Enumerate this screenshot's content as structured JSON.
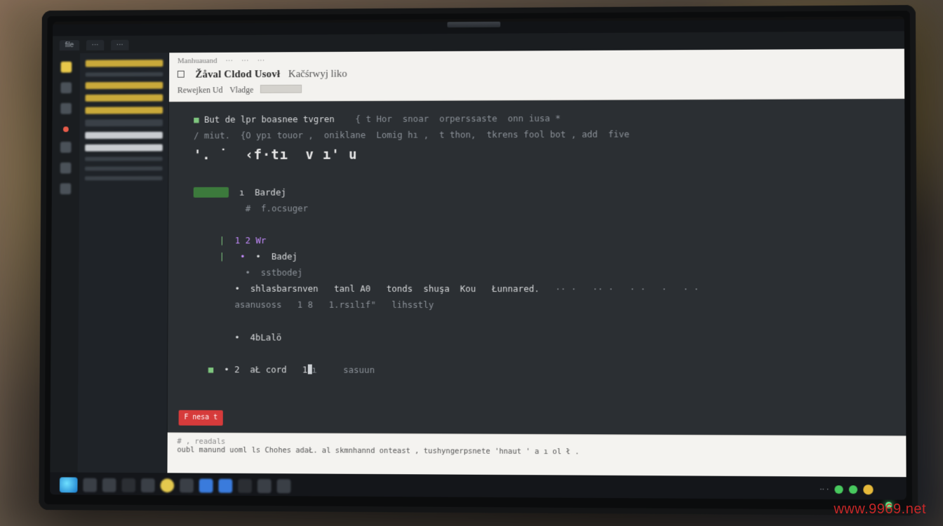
{
  "watermark": "www.9969.net",
  "ide": {
    "tabs": [
      "file",
      "···",
      "···"
    ]
  },
  "doc": {
    "crumb": [
      "Manhuauand",
      "···",
      "···",
      "···"
    ],
    "title_a": "Žåval  Cldod Usovł",
    "title_b": "Kačśrwyj liko",
    "sub_a": "Rewejken Ud",
    "sub_b": "Vladge"
  },
  "code": {
    "l1a": "But de lpr boasnee tvgren",
    "l1b": "{ t Hor  snoar  orperssaste  onn iusa *",
    "l2": "/ miut.  {O ypı touor ,  oniklane  Lomig hı ,  t thon,  tkrens fool bot , add  five",
    "l3": "'. ˙  ‹f·tı  v ı' u",
    "l4": "ı  Bardej",
    "l5": "#  f.ocsuger",
    "l6": "1 2 Wr",
    "l7": "•  Badej",
    "l8": "•  sstbodej",
    "l9": "•  shlasbarsnven   tanl A0   tonds  shuşa  Kou   Łunnared.",
    "l10": "asanusoss   1 8   1.rsılıf\"   lihsstly",
    "l11": "•  4bLalö",
    "l12": "• 2  aŁ cord   1",
    "l12b": "ı     sasuun"
  },
  "redtag": "F nesa t",
  "panel": {
    "p1": "# , readals",
    "p2": "oubl   manund   uoml  ls  Chohes adaŁ.  al   skmnhannd onteast ,  tushyngerpsnete   'hnaut  ' a ı ol  ł ."
  }
}
